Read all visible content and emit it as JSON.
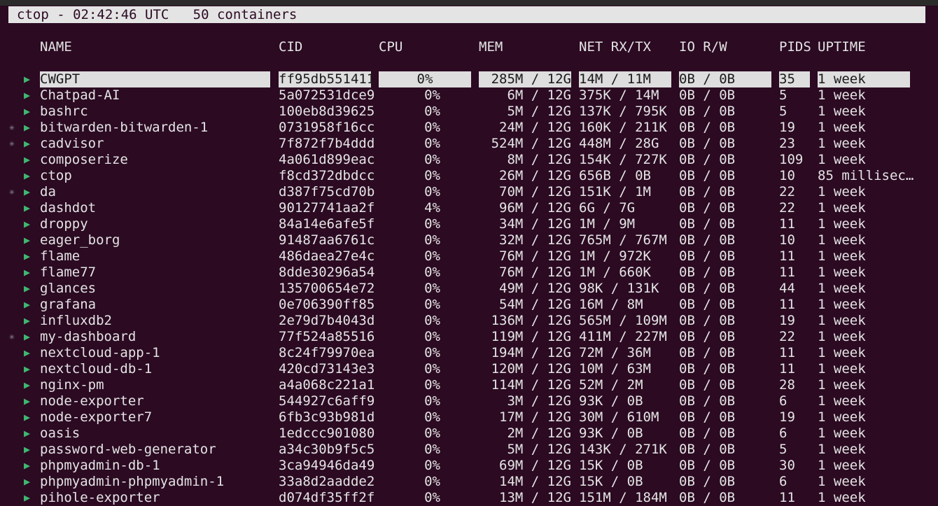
{
  "header": {
    "text": "ctop - 02:42:46 UTC   50 containers"
  },
  "columns": {
    "name": "NAME",
    "cid": "CID",
    "cpu": "CPU",
    "mem": "MEM",
    "net": "NET RX/TX",
    "io": "IO R/W",
    "pids": "PIDS",
    "uptime": "UPTIME"
  },
  "glyphs": {
    "arrow": "▶",
    "star": "✳"
  },
  "rows": [
    {
      "name": "CWGPT",
      "cid": "ff95db551411",
      "cpu": "0%",
      "mem": "285M / 12G",
      "net": "14M / 11M",
      "io": "0B / 0B",
      "pids": "35",
      "uptime": "1 week",
      "selected": true,
      "star": false
    },
    {
      "name": "Chatpad-AI",
      "cid": "5a072531dce9",
      "cpu": "0%",
      "mem": "6M / 12G",
      "net": "375K / 14M",
      "io": "0B / 0B",
      "pids": "5",
      "uptime": "1 week",
      "star": false
    },
    {
      "name": "bashrc",
      "cid": "100eb8d39625",
      "cpu": "0%",
      "mem": "5M / 12G",
      "net": "137K / 795K",
      "io": "0B / 0B",
      "pids": "5",
      "uptime": "1 week",
      "star": false
    },
    {
      "name": "bitwarden-bitwarden-1",
      "cid": "0731958f16cc",
      "cpu": "0%",
      "mem": "24M / 12G",
      "net": "160K / 211K",
      "io": "0B / 0B",
      "pids": "19",
      "uptime": "1 week",
      "star": true
    },
    {
      "name": "cadvisor",
      "cid": "7f872f7b4ddd",
      "cpu": "0%",
      "mem": "524M / 12G",
      "net": "448M / 28G",
      "io": "0B / 0B",
      "pids": "23",
      "uptime": "1 week",
      "star": true
    },
    {
      "name": "composerize",
      "cid": "4a061d899eac",
      "cpu": "0%",
      "mem": "8M / 12G",
      "net": "154K / 727K",
      "io": "0B / 0B",
      "pids": "109",
      "uptime": "1 week",
      "star": false
    },
    {
      "name": "ctop",
      "cid": "f8cd372dbdcc",
      "cpu": "0%",
      "mem": "26M / 12G",
      "net": "656B / 0B",
      "io": "0B / 0B",
      "pids": "10",
      "uptime": "85 millisec…",
      "star": false
    },
    {
      "name": "da",
      "cid": "d387f75cd70b",
      "cpu": "0%",
      "mem": "70M / 12G",
      "net": "151K / 1M",
      "io": "0B / 0B",
      "pids": "22",
      "uptime": "1 week",
      "star": true
    },
    {
      "name": "dashdot",
      "cid": "90127741aa2f",
      "cpu": "4%",
      "mem": "96M / 12G",
      "net": "6G / 7G",
      "io": "0B / 0B",
      "pids": "22",
      "uptime": "1 week",
      "star": false
    },
    {
      "name": "droppy",
      "cid": "84a14e6afe5f",
      "cpu": "0%",
      "mem": "34M / 12G",
      "net": "1M / 9M",
      "io": "0B / 0B",
      "pids": "11",
      "uptime": "1 week",
      "star": false
    },
    {
      "name": "eager_borg",
      "cid": "91487aa6761c",
      "cpu": "0%",
      "mem": "32M / 12G",
      "net": "765M / 767M",
      "io": "0B / 0B",
      "pids": "10",
      "uptime": "1 week",
      "star": false
    },
    {
      "name": "flame",
      "cid": "486daea27e4c",
      "cpu": "0%",
      "mem": "76M / 12G",
      "net": "1M / 972K",
      "io": "0B / 0B",
      "pids": "11",
      "uptime": "1 week",
      "star": false
    },
    {
      "name": "flame77",
      "cid": "8dde30296a54",
      "cpu": "0%",
      "mem": "76M / 12G",
      "net": "1M / 660K",
      "io": "0B / 0B",
      "pids": "11",
      "uptime": "1 week",
      "star": false
    },
    {
      "name": "glances",
      "cid": "135700654e72",
      "cpu": "0%",
      "mem": "49M / 12G",
      "net": "98K / 131K",
      "io": "0B / 0B",
      "pids": "44",
      "uptime": "1 week",
      "star": false
    },
    {
      "name": "grafana",
      "cid": "0e706390ff85",
      "cpu": "0%",
      "mem": "54M / 12G",
      "net": "16M / 8M",
      "io": "0B / 0B",
      "pids": "11",
      "uptime": "1 week",
      "star": false
    },
    {
      "name": "influxdb2",
      "cid": "2e79d7b4043d",
      "cpu": "0%",
      "mem": "136M / 12G",
      "net": "565M / 109M",
      "io": "0B / 0B",
      "pids": "19",
      "uptime": "1 week",
      "star": false
    },
    {
      "name": "my-dashboard",
      "cid": "77f524a85516",
      "cpu": "0%",
      "mem": "119M / 12G",
      "net": "411M / 227M",
      "io": "0B / 0B",
      "pids": "22",
      "uptime": "1 week",
      "star": true
    },
    {
      "name": "nextcloud-app-1",
      "cid": "8c24f79970ea",
      "cpu": "0%",
      "mem": "194M / 12G",
      "net": "72M / 36M",
      "io": "0B / 0B",
      "pids": "11",
      "uptime": "1 week",
      "star": false
    },
    {
      "name": "nextcloud-db-1",
      "cid": "420cd73143e3",
      "cpu": "0%",
      "mem": "120M / 12G",
      "net": "10M / 63M",
      "io": "0B / 0B",
      "pids": "11",
      "uptime": "1 week",
      "star": false
    },
    {
      "name": "nginx-pm",
      "cid": "a4a068c221a1",
      "cpu": "0%",
      "mem": "114M / 12G",
      "net": "52M / 2M",
      "io": "0B / 0B",
      "pids": "28",
      "uptime": "1 week",
      "star": false
    },
    {
      "name": "node-exporter",
      "cid": "544927c6aff9",
      "cpu": "0%",
      "mem": "3M / 12G",
      "net": "93K / 0B",
      "io": "0B / 0B",
      "pids": "6",
      "uptime": "1 week",
      "star": false
    },
    {
      "name": "node-exporter7",
      "cid": "6fb3c93b981d",
      "cpu": "0%",
      "mem": "17M / 12G",
      "net": "30M / 610M",
      "io": "0B / 0B",
      "pids": "19",
      "uptime": "1 week",
      "star": false
    },
    {
      "name": "oasis",
      "cid": "1edccc901080",
      "cpu": "0%",
      "mem": "2M / 12G",
      "net": "93K / 0B",
      "io": "0B / 0B",
      "pids": "6",
      "uptime": "1 week",
      "star": false
    },
    {
      "name": "password-web-generator",
      "cid": "a34c30b9f5c5",
      "cpu": "0%",
      "mem": "5M / 12G",
      "net": "143K / 271K",
      "io": "0B / 0B",
      "pids": "5",
      "uptime": "1 week",
      "star": false
    },
    {
      "name": "phpmyadmin-db-1",
      "cid": "3ca94946da49",
      "cpu": "0%",
      "mem": "69M / 12G",
      "net": "15K / 0B",
      "io": "0B / 0B",
      "pids": "30",
      "uptime": "1 week",
      "star": false
    },
    {
      "name": "phpmyadmin-phpmyadmin-1",
      "cid": "33a8d2aadde2",
      "cpu": "0%",
      "mem": "14M / 12G",
      "net": "15K / 0B",
      "io": "0B / 0B",
      "pids": "6",
      "uptime": "1 week",
      "star": false
    },
    {
      "name": "pihole-exporter",
      "cid": "d074df35ff2f",
      "cpu": "0%",
      "mem": "13M / 12G",
      "net": "151M / 184M",
      "io": "0B / 0B",
      "pids": "11",
      "uptime": "1 week",
      "star": false
    }
  ]
}
